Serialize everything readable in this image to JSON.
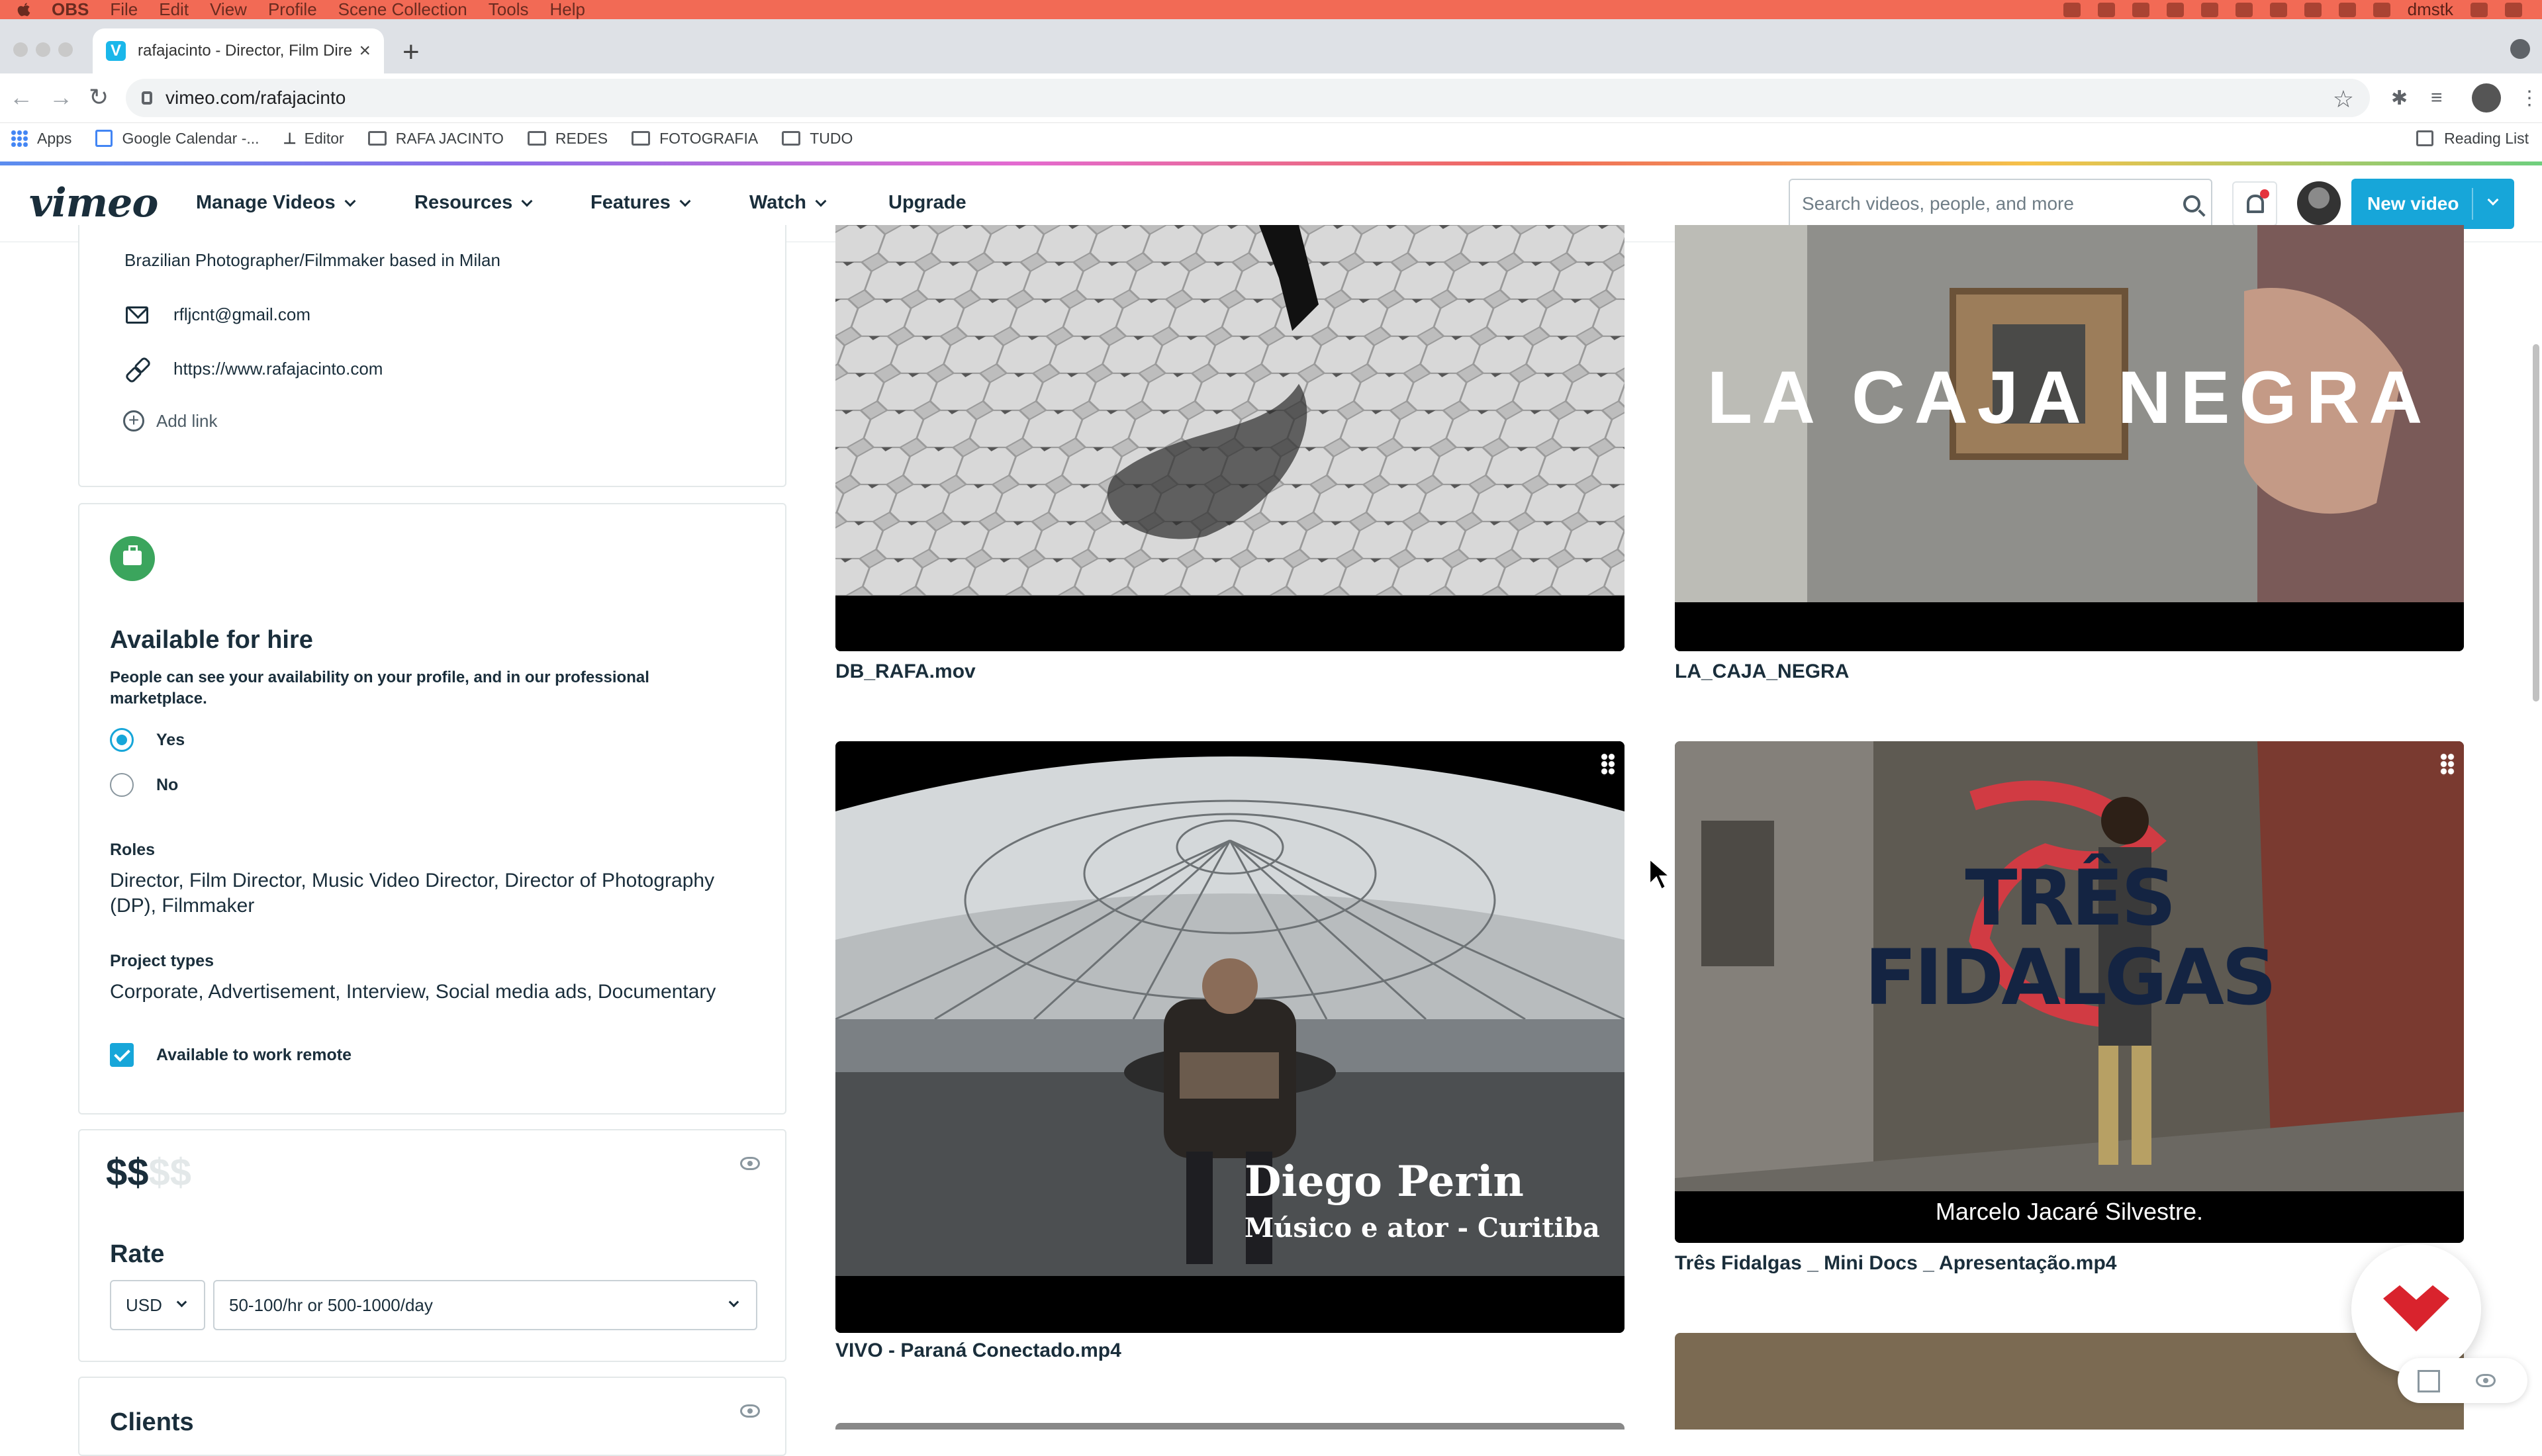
{
  "menubar": {
    "app": "OBS",
    "items": [
      "File",
      "Edit",
      "View",
      "Profile",
      "Scene Collection",
      "Tools",
      "Help"
    ],
    "user": "dmstk"
  },
  "browser": {
    "tab_title": "rafajacinto - Director, Film Dire",
    "tab_favicon": "V",
    "url": "vimeo.com/rafajacinto",
    "bookmarks": [
      "Apps",
      "Google Calendar -...",
      "Editor",
      "RAFA JACINTO",
      "REDES",
      "FOTOGRAFIA",
      "TUDO"
    ],
    "reading_list": "Reading List"
  },
  "header": {
    "logo": "vimeo",
    "nav": [
      "Manage Videos",
      "Resources",
      "Features",
      "Watch",
      "Upgrade"
    ],
    "search_placeholder": "Search videos, people, and more",
    "new_video": "New video",
    "accent": "#17a6d9"
  },
  "profile": {
    "bio": "Brazilian Photographer/Filmmaker based in Milan",
    "email": "rfljcnt@gmail.com",
    "website": "https://www.rafajacinto.com",
    "add_link": "Add link"
  },
  "hire": {
    "title": "Available for hire",
    "description": "People can see your availability on your profile, and in our professional marketplace.",
    "options": [
      "Yes",
      "No"
    ],
    "selected": "Yes",
    "roles_label": "Roles",
    "roles": "Director, Film Director, Music Video Director, Director of Photography (DP), Filmmaker",
    "project_types_label": "Project types",
    "project_types": "Corporate, Advertisement, Interview, Social media ads, Documentary",
    "remote_label": "Available to work remote",
    "remote_checked": true
  },
  "rate": {
    "price_level": "$$",
    "price_dim": "$$",
    "label": "Rate",
    "currency": "USD",
    "range": "50-100/hr or 500-1000/day"
  },
  "clients": {
    "label": "Clients"
  },
  "videos": [
    {
      "title": "DB_RAFA.mov"
    },
    {
      "title": "LA_CAJA_NEGRA",
      "overlay": "LA CAJA NEGRA"
    },
    {
      "title": "VIVO - Paraná Conectado.mp4",
      "overlay_name": "Diego Perin",
      "overlay_sub": "Músico e ator - Curitiba"
    },
    {
      "title": "Três Fidalgas _ Mini Docs _ Apresentação.mp4",
      "overlay_line1": "TRÊS",
      "overlay_line2": "FIDALGAS",
      "caption": "Marcelo Jacaré Silvestre."
    }
  ]
}
